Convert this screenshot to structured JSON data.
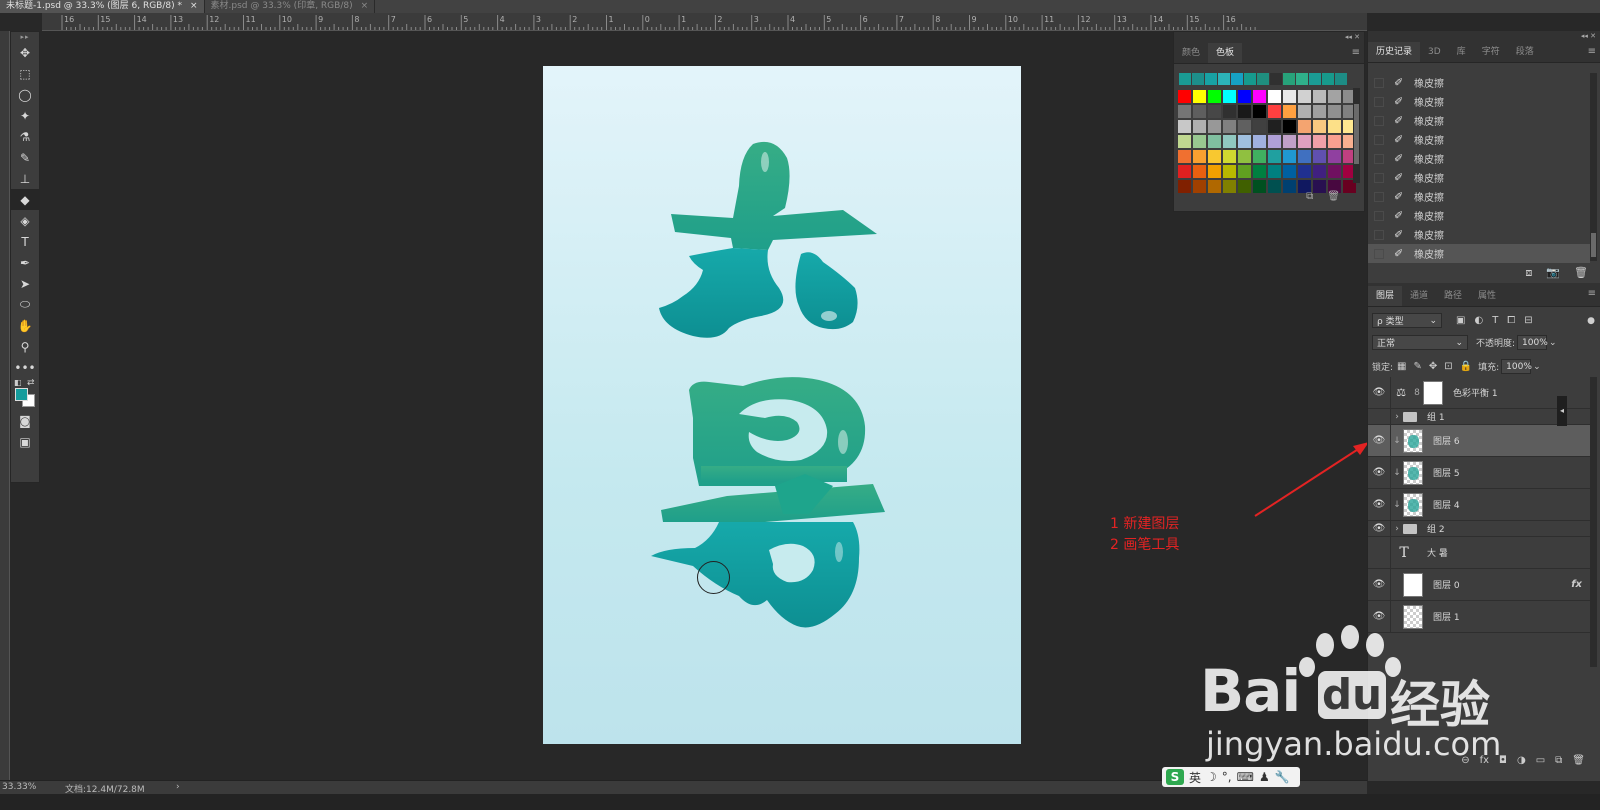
{
  "doc_tabs": [
    {
      "label": "未标题-1.psd @ 33.3% (图层 6, RGB/8) *",
      "close": "×",
      "active": true
    },
    {
      "label": "素材.psd @ 33.3% (印章, RGB/8)",
      "close": "×",
      "active": false
    }
  ],
  "ruler_labels": [
    "16",
    "15",
    "14",
    "13",
    "12",
    "11",
    "10",
    "9",
    "8",
    "7",
    "6",
    "5",
    "4",
    "3",
    "2",
    "1",
    "0",
    "1",
    "2",
    "3",
    "4",
    "5",
    "6",
    "7",
    "8",
    "9",
    "10",
    "11",
    "12",
    "13",
    "14",
    "15",
    "16"
  ],
  "toolbar": {
    "grip": "▸▸",
    "tools": [
      {
        "name": "move-tool",
        "glyph": "✥"
      },
      {
        "name": "marquee-tool",
        "glyph": "⬚"
      },
      {
        "name": "lasso-tool",
        "glyph": "◯"
      },
      {
        "name": "magic-wand-tool",
        "glyph": "✦"
      },
      {
        "name": "eyedropper-tool",
        "glyph": "⚗"
      },
      {
        "name": "brush-tool",
        "glyph": "✎"
      },
      {
        "name": "stamp-tool",
        "glyph": "⊥"
      },
      {
        "name": "eraser-tool",
        "glyph": "◆"
      },
      {
        "name": "paint-bucket-tool",
        "glyph": "◈"
      },
      {
        "name": "type-tool",
        "glyph": "T"
      },
      {
        "name": "pen-tool",
        "glyph": "✒"
      },
      {
        "name": "path-selection-tool",
        "glyph": "➤"
      },
      {
        "name": "ellipse-tool",
        "glyph": "⬭"
      },
      {
        "name": "hand-tool",
        "glyph": "✋"
      },
      {
        "name": "zoom-tool",
        "glyph": "⚲"
      },
      {
        "name": "more-tools",
        "glyph": "•••"
      }
    ],
    "active_tool": 7,
    "fg_color": "#159c9c",
    "bg_color": "#ffffff"
  },
  "canvas": {
    "bg_top": "#e3f4fa",
    "bg_bottom": "#bde3ec",
    "art_green": "#2fa98a",
    "art_teal": "#13a7a8"
  },
  "annotation": {
    "line1": "1 新建图层",
    "line2": "2 画笔工具",
    "color": "#e32323"
  },
  "status": {
    "zoom": "33.33%",
    "doc": "文档:12.4M/72.8M",
    "arrow": "›"
  },
  "ime": {
    "logo": "S",
    "lang": "英",
    "icons": [
      "☽",
      "°,",
      "⌨",
      "♟",
      "🔧"
    ]
  },
  "swatch_panel": {
    "strip": "◂◂ ✕",
    "tabs": [
      "颜色",
      "色板"
    ],
    "active_tab": 1,
    "menu": "≡",
    "recent": [
      "#1a9b94",
      "#1d8f8b",
      "#18a2a4",
      "#2cb3b8",
      "#16a1c4",
      "#169b8e",
      "#1f8f7f",
      "#303030",
      "#27a27a",
      "#2fb08a",
      "#1b9c95",
      "#179a8c",
      "#1d8c85"
    ],
    "grid": [
      "#ff0000",
      "#ffff00",
      "#00ff00",
      "#00ffff",
      "#0000ff",
      "#ff00ff",
      "#ffffff",
      "#e8e8e8",
      "#d1d1d1",
      "#bababa",
      "#a3a3a3",
      "#8c8c8c",
      "#757575",
      "#5e5e5e",
      "#474747",
      "#303030",
      "#191919",
      "#000000",
      "#ff4040",
      "#ffa040",
      "#b0b0b0",
      "#a0a0a0",
      "#909090",
      "#808080",
      "#c8c8c8",
      "#b0b0b0",
      "#989898",
      "#808080",
      "#606060",
      "#404040",
      "#202020",
      "#000000",
      "#f4a470",
      "#f8c880",
      "#fce088",
      "#ffe890",
      "#c0d890",
      "#98c890",
      "#80c0a0",
      "#90c8c0",
      "#a0c0e0",
      "#a0b0e0",
      "#b0a0d8",
      "#c0a0c8",
      "#e0a0c0",
      "#f0a0a8",
      "#f8a090",
      "#f8b090",
      "#f07030",
      "#f8a030",
      "#f8c830",
      "#d0d830",
      "#90c040",
      "#40b060",
      "#20a0a0",
      "#2098d0",
      "#4070c0",
      "#6050b0",
      "#9040a0",
      "#c04080",
      "#e02020",
      "#e86010",
      "#f0a000",
      "#b8b800",
      "#60a020",
      "#008040",
      "#008080",
      "#0060a0",
      "#203090",
      "#402080",
      "#701060",
      "#a00040",
      "#802000",
      "#a04000",
      "#b06800",
      "#808000",
      "#406000",
      "#005020",
      "#005050",
      "#004070",
      "#101860",
      "#281050",
      "#480840",
      "#680020"
    ],
    "footer": [
      "⧉",
      "🗑"
    ]
  },
  "history_panel": {
    "strip": "◂◂ ✕",
    "tabs": [
      "历史记录",
      "3D",
      "库",
      "字符",
      "段落"
    ],
    "active_tab": 0,
    "menu": "≡",
    "items": [
      "橡皮擦",
      "橡皮擦",
      "橡皮擦",
      "橡皮擦",
      "橡皮擦",
      "橡皮擦",
      "橡皮擦",
      "橡皮擦",
      "橡皮擦",
      "橡皮擦"
    ],
    "item_icon": "✐",
    "selected": 9,
    "footer": [
      "⧈",
      "📷",
      "🗑"
    ]
  },
  "layers_panel": {
    "tabs": [
      "图层",
      "通道",
      "路径",
      "属性"
    ],
    "active_tab": 0,
    "menu": "≡",
    "filter_label": "ρ 类型",
    "filter_icons": [
      "▣",
      "◐",
      "T",
      "⧠",
      "⊟"
    ],
    "filter_toggle": "●",
    "blend_mode": "正常",
    "opacity_label": "不透明度:",
    "opacity_value": "100%",
    "lock_label": "锁定:",
    "lock_icons": [
      "▦",
      "✎",
      "✥",
      "⊡",
      "🔒"
    ],
    "fill_label": "填充:",
    "fill_value": "100%",
    "dropdown_caret": "⌄",
    "layers": [
      {
        "kind": "adjust",
        "name": "色彩平衡 1",
        "visible": true,
        "icon": "⚖",
        "link": "8"
      },
      {
        "kind": "group",
        "name": "组 1",
        "visible": false,
        "chev": "›"
      },
      {
        "kind": "pixel",
        "name": "图层 6",
        "visible": true,
        "clip": "↓",
        "selected": true
      },
      {
        "kind": "pixel",
        "name": "图层 5",
        "visible": true,
        "clip": "↓"
      },
      {
        "kind": "pixel",
        "name": "图层 4",
        "visible": true,
        "clip": "↓"
      },
      {
        "kind": "group",
        "name": "组 2",
        "visible": true,
        "chev": "›"
      },
      {
        "kind": "text",
        "name": "大 暑",
        "visible": false,
        "icon": "T"
      },
      {
        "kind": "white",
        "name": "图层 0",
        "visible": true,
        "fx": "fx"
      },
      {
        "kind": "pixel",
        "name": "图层 1",
        "visible": true
      }
    ],
    "eye_glyph": "👁",
    "footer": [
      "⊖",
      "fx",
      "◘",
      "◑",
      "▭",
      "⧉",
      "🗑"
    ]
  },
  "side_button": "◂",
  "watermark": {
    "brand_left": "Bai",
    "brand_mid": "du",
    "brand_right": "经验",
    "url": "jingyan.baidu.com"
  }
}
